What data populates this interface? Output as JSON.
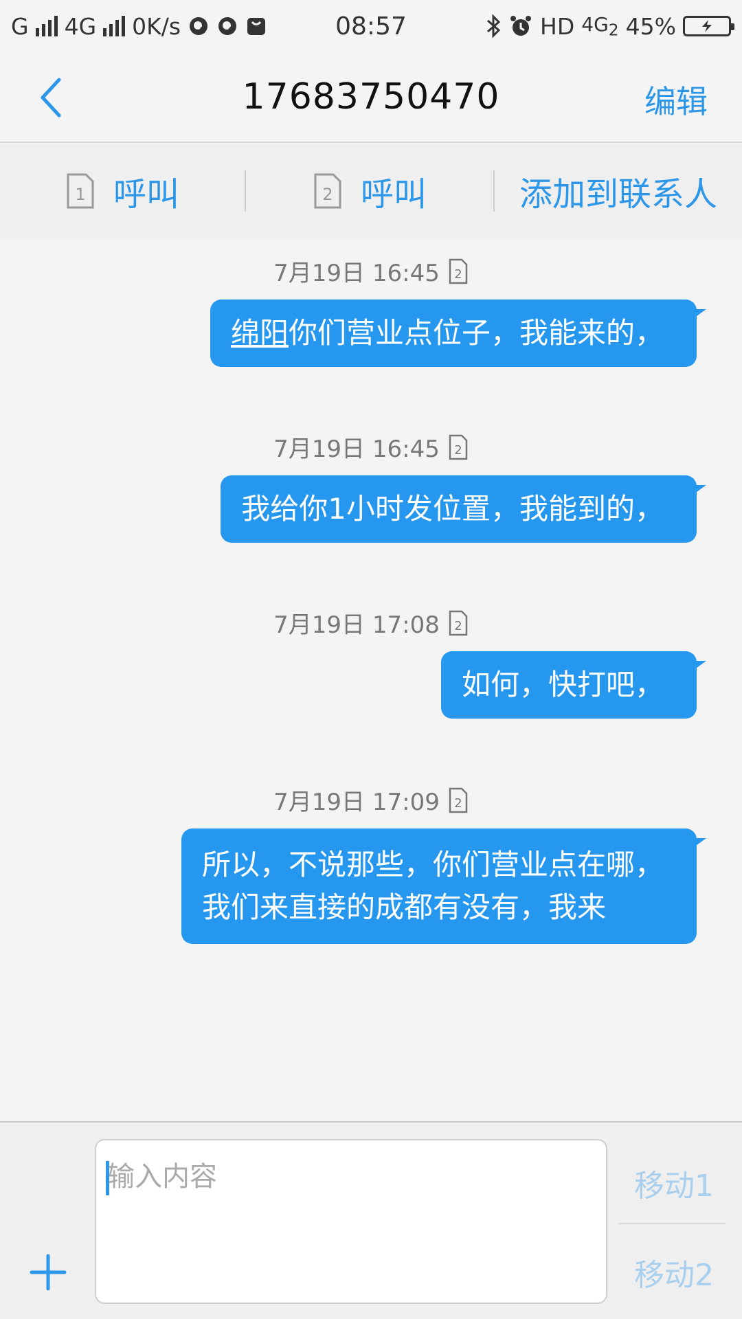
{
  "status_bar": {
    "network1": "G",
    "network2": "4G",
    "speed": "0K/s",
    "time": "08:57",
    "hd_label": "HD",
    "net_label": "4G",
    "net_sub": "2",
    "battery_pct": "45%"
  },
  "header": {
    "title": "17683750470",
    "edit_label": "编辑"
  },
  "actions": {
    "call1_label": "呼叫",
    "call1_sim": "1",
    "call2_label": "呼叫",
    "call2_sim": "2",
    "add_contact_label": "添加到联系人"
  },
  "messages": [
    {
      "timestamp": "7月19日 16:45",
      "sim": "2",
      "link_text": "绵阳",
      "text": "你们营业点位子，我能来的，"
    },
    {
      "timestamp": "7月19日 16:45",
      "sim": "2",
      "text": "我给你1小时发位置，我能到的，"
    },
    {
      "timestamp": "7月19日 17:08",
      "sim": "2",
      "text": "如何，快打吧，"
    },
    {
      "timestamp": "7月19日 17:09",
      "sim": "2",
      "line1": "所以，不说那些，你们营业点在哪，",
      "line2": "我们来直接的成都有没有，我来"
    }
  ],
  "composer": {
    "placeholder": "输入内容",
    "send1_label": "移动1",
    "send2_label": "移动2"
  },
  "colors": {
    "accent": "#2c96e8",
    "bubble": "#2697ee",
    "send_disabled": "#a9cfee"
  }
}
